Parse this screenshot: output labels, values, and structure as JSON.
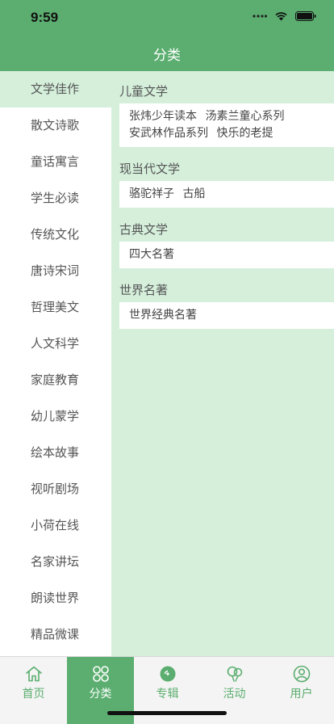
{
  "status": {
    "time": "9:59"
  },
  "header": {
    "title": "分类"
  },
  "sidebar": {
    "items": [
      {
        "label": "文学佳作"
      },
      {
        "label": "散文诗歌"
      },
      {
        "label": "童话寓言"
      },
      {
        "label": "学生必读"
      },
      {
        "label": "传统文化"
      },
      {
        "label": "唐诗宋词"
      },
      {
        "label": "哲理美文"
      },
      {
        "label": "人文科学"
      },
      {
        "label": "家庭教育"
      },
      {
        "label": "幼儿蒙学"
      },
      {
        "label": "绘本故事"
      },
      {
        "label": "视听剧场"
      },
      {
        "label": "小荷在线"
      },
      {
        "label": "名家讲坛"
      },
      {
        "label": "朗读世界"
      },
      {
        "label": "精品微课"
      }
    ]
  },
  "content": {
    "sections": [
      {
        "title": "儿童文学",
        "tags": [
          "张炜少年读本",
          "汤素兰童心系列",
          "安武林作品系列",
          "快乐的老提"
        ]
      },
      {
        "title": "现当代文学",
        "tags": [
          "骆驼祥子",
          "古船"
        ]
      },
      {
        "title": "古典文学",
        "tags": [
          "四大名著"
        ]
      },
      {
        "title": "世界名著",
        "tags": [
          "世界经典名著"
        ]
      }
    ]
  },
  "tabbar": {
    "tabs": [
      {
        "label": "首页",
        "icon": "home-icon"
      },
      {
        "label": "分类",
        "icon": "category-icon"
      },
      {
        "label": "专辑",
        "icon": "album-icon"
      },
      {
        "label": "活动",
        "icon": "activity-icon"
      },
      {
        "label": "用户",
        "icon": "user-icon"
      }
    ]
  },
  "colors": {
    "primary": "#5bae6f",
    "light": "#d5efdb"
  }
}
